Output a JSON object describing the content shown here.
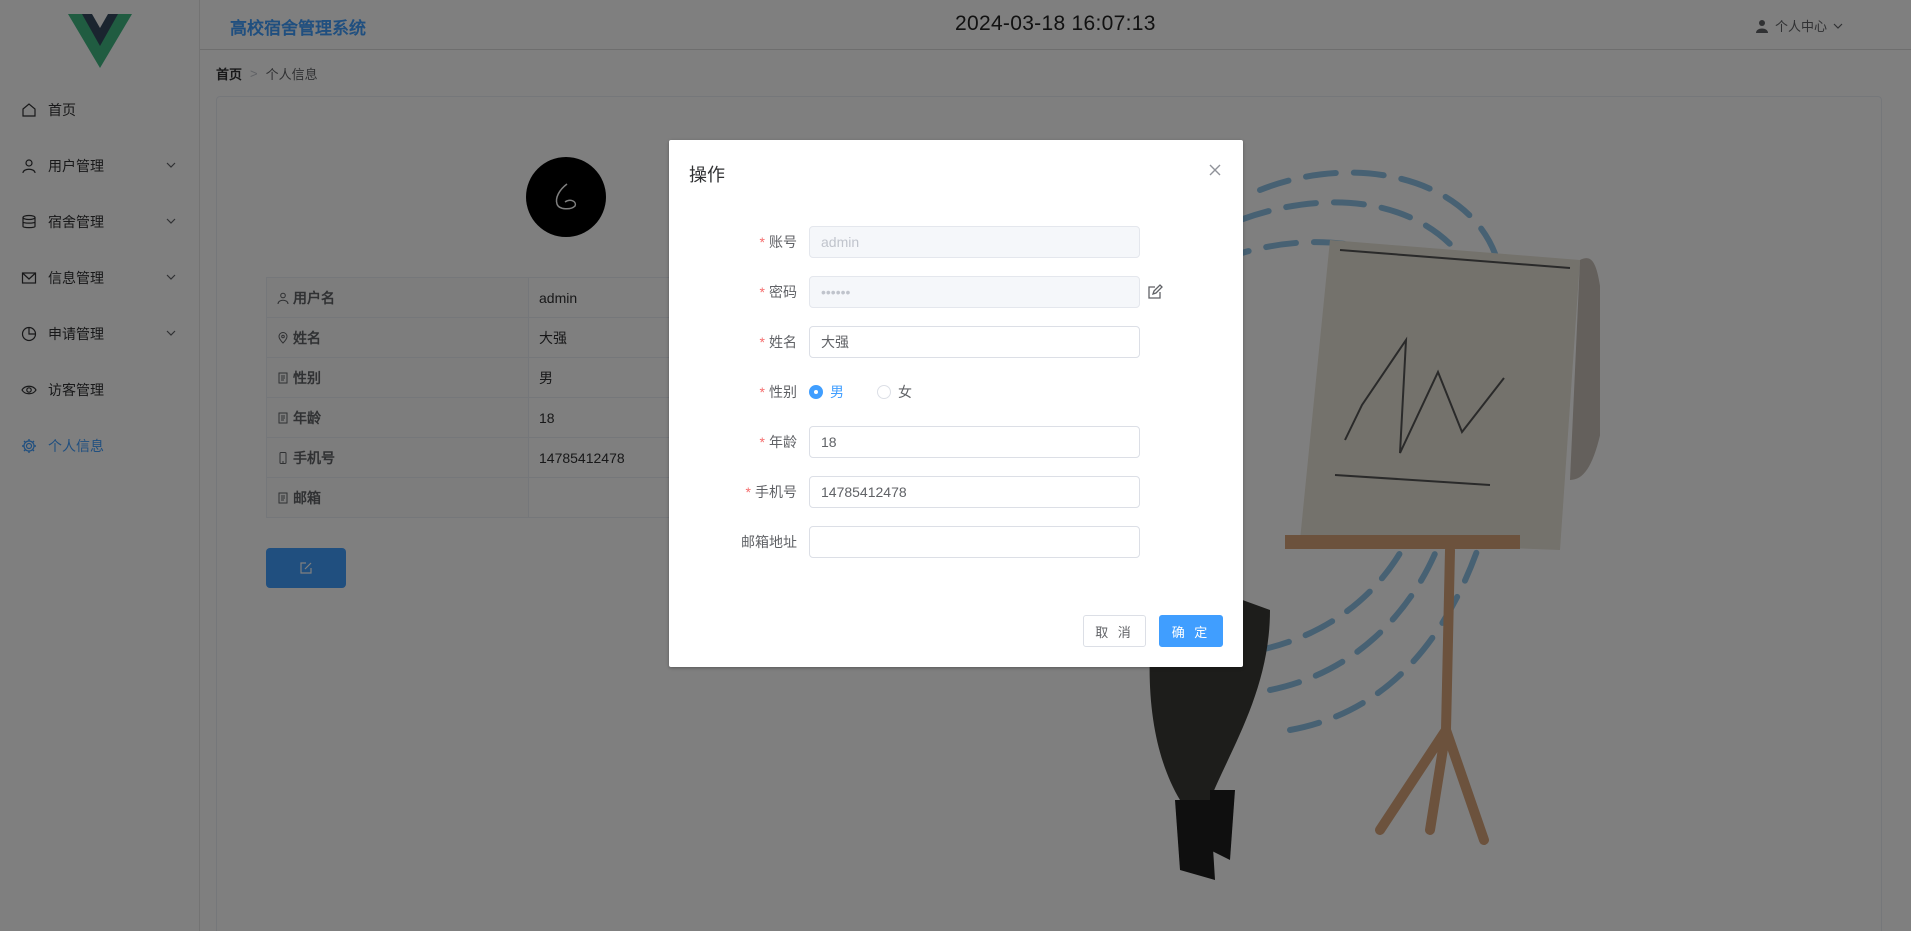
{
  "header": {
    "app_title": "高校宿舍管理系统",
    "clock": "2024-03-18 16:07:13",
    "user_center": "个人中心"
  },
  "sidebar": {
    "items": [
      {
        "label": "首页",
        "icon": "home-icon",
        "has_submenu": false
      },
      {
        "label": "用户管理",
        "icon": "user-icon",
        "has_submenu": true
      },
      {
        "label": "宿舍管理",
        "icon": "database-icon",
        "has_submenu": true
      },
      {
        "label": "信息管理",
        "icon": "message-icon",
        "has_submenu": true
      },
      {
        "label": "申请管理",
        "icon": "pie-chart-icon",
        "has_submenu": true
      },
      {
        "label": "访客管理",
        "icon": "eye-icon",
        "has_submenu": false
      },
      {
        "label": "个人信息",
        "icon": "gear-icon",
        "has_submenu": false,
        "active": true
      }
    ]
  },
  "breadcrumb": {
    "home": "首页",
    "separator": ">",
    "current": "个人信息"
  },
  "profile": {
    "rows": [
      {
        "label": "用户名",
        "value": "admin",
        "icon": "user-icon"
      },
      {
        "label": "姓名",
        "value": "大强",
        "icon": "location-icon"
      },
      {
        "label": "性别",
        "value": "男",
        "icon": "document-icon"
      },
      {
        "label": "年龄",
        "value": "18",
        "icon": "document-icon"
      },
      {
        "label": "手机号",
        "value": "14785412478",
        "icon": "phone-icon"
      },
      {
        "label": "邮箱",
        "value": "",
        "icon": "document-icon"
      }
    ]
  },
  "dialog": {
    "title": "操作",
    "fields": {
      "account": {
        "label": "账号",
        "value": "admin",
        "required": true,
        "disabled": true
      },
      "password": {
        "label": "密码",
        "value": "••••••",
        "required": true,
        "disabled": true
      },
      "name": {
        "label": "姓名",
        "value": "大强",
        "required": true
      },
      "gender": {
        "label": "性别",
        "required": true,
        "options": [
          "男",
          "女"
        ],
        "selected": "男"
      },
      "age": {
        "label": "年龄",
        "value": "18",
        "required": true
      },
      "phone": {
        "label": "手机号",
        "value": "14785412478",
        "required": true
      },
      "email": {
        "label": "邮箱地址",
        "value": "",
        "required": false
      }
    },
    "required_mark": "*",
    "cancel_label": "取 消",
    "confirm_label": "确 定"
  },
  "colors": {
    "primary": "#409eff",
    "required": "#f56c6c",
    "overlay": "rgba(0,0,0,0.5)"
  }
}
